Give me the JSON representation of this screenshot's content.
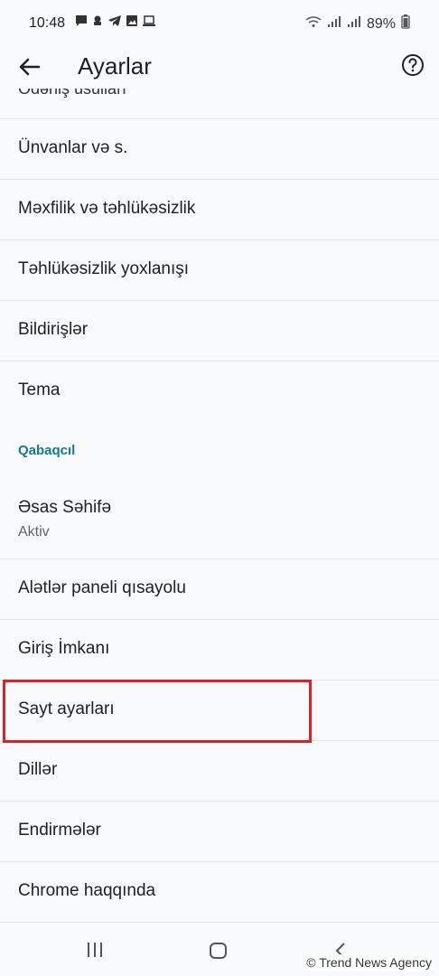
{
  "status_bar": {
    "time": "10:48",
    "battery": "89%",
    "left_icons": [
      "message-icon",
      "notification-icon",
      "telegram-icon",
      "gallery-icon",
      "laptop-icon"
    ],
    "right_icons": [
      "wifi-icon",
      "signal-icon",
      "signal-icon",
      "battery-icon"
    ]
  },
  "app_bar": {
    "title": "Ayarlar",
    "back_icon": "arrow-back-icon",
    "help_icon": "help-icon"
  },
  "list": {
    "cut_item": "Ödəniş üsulları",
    "items_before": [
      {
        "label": "Ünvanlar və s."
      },
      {
        "label": "Məxfilik və təhlükəsizlik"
      },
      {
        "label": "Təhlükəsizlik yoxlanışı"
      },
      {
        "label": "Bildirişlər"
      },
      {
        "label": "Tema"
      }
    ],
    "section_header": "Qabaqcıl",
    "home_page": {
      "label": "Əsas Səhifə",
      "sublabel": "Aktiv"
    },
    "items_after": [
      {
        "label": "Alətlər paneli qısayolu"
      },
      {
        "label": "Giriş İmkanı"
      },
      {
        "label": "Sayt ayarları"
      },
      {
        "label": "Dillər"
      },
      {
        "label": "Endirmələr"
      },
      {
        "label": "Chrome haqqında"
      }
    ]
  },
  "highlight": {
    "color": "#d7222a"
  },
  "nav_bar": {
    "icons": [
      "recents-icon",
      "home-icon",
      "back-icon"
    ]
  },
  "watermark": "© Trend News Agency"
}
